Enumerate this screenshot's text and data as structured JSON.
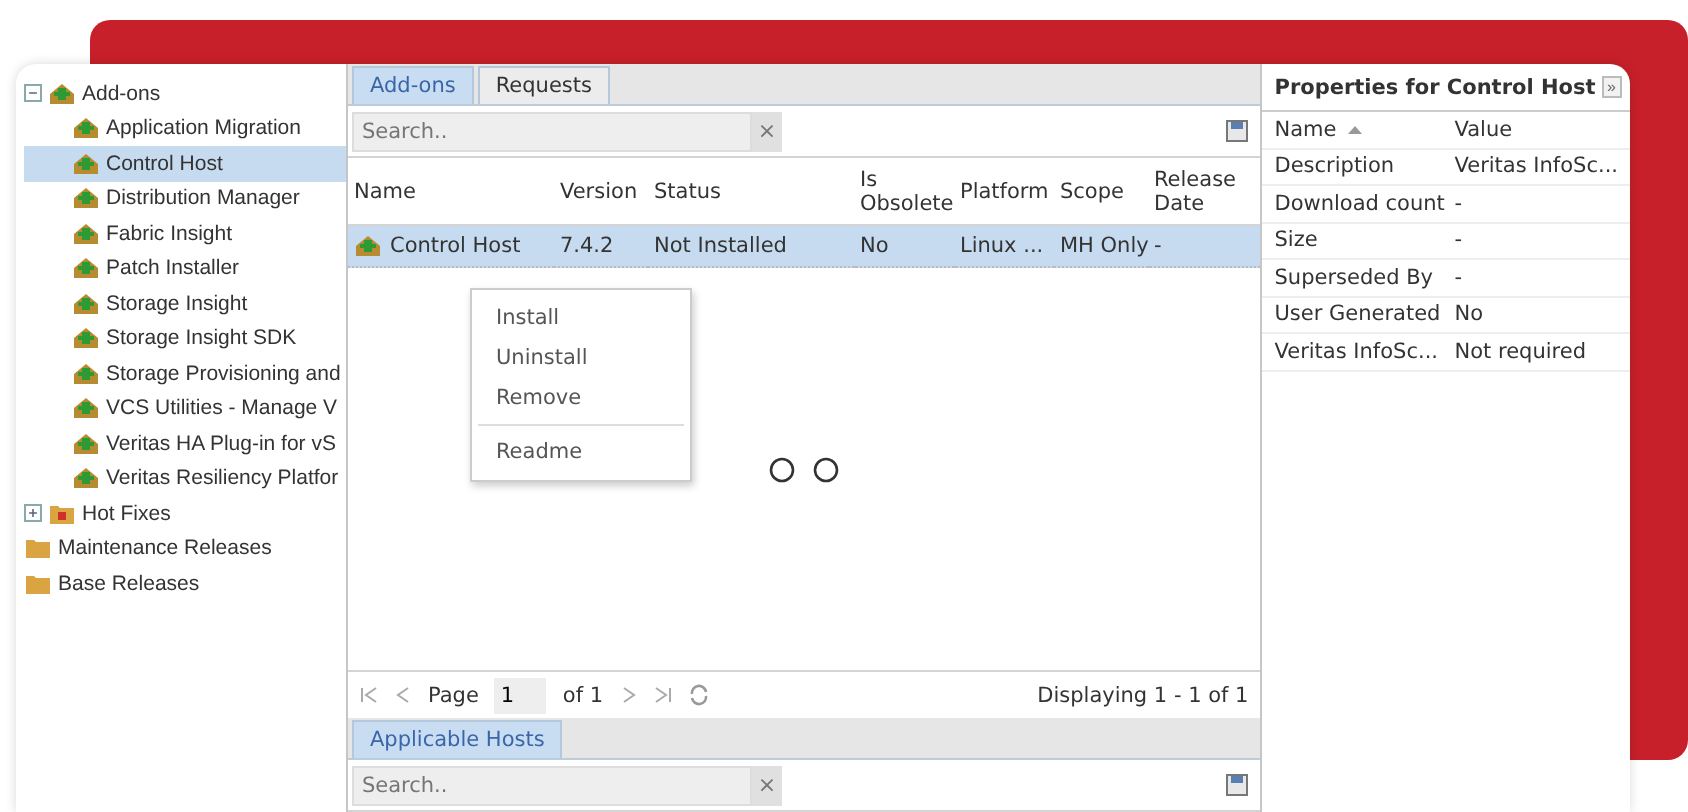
{
  "tree": [
    {
      "label": "Add-ons",
      "kind": "package-folder",
      "expanded": true,
      "selected": false,
      "children": [
        {
          "label": "Application Migration",
          "kind": "package",
          "selected": false
        },
        {
          "label": "Control Host",
          "kind": "package",
          "selected": true
        },
        {
          "label": "Distribution Manager",
          "kind": "package",
          "selected": false
        },
        {
          "label": "Fabric Insight",
          "kind": "package",
          "selected": false
        },
        {
          "label": "Patch Installer",
          "kind": "package",
          "selected": false
        },
        {
          "label": "Storage Insight",
          "kind": "package",
          "selected": false
        },
        {
          "label": "Storage Insight SDK",
          "kind": "package",
          "selected": false
        },
        {
          "label": "Storage Provisioning and",
          "kind": "package",
          "selected": false
        },
        {
          "label": "VCS Utilities - Manage V",
          "kind": "package",
          "selected": false
        },
        {
          "label": "Veritas HA Plug-in for vS",
          "kind": "package",
          "selected": false
        },
        {
          "label": "Veritas Resiliency Platfor",
          "kind": "package",
          "selected": false
        }
      ]
    },
    {
      "label": "Hot Fixes",
      "kind": "hotfix",
      "expanded": false,
      "selected": false
    },
    {
      "label": "Maintenance Releases",
      "kind": "folder",
      "selected": false
    },
    {
      "label": "Base Releases",
      "kind": "folder",
      "selected": false
    }
  ],
  "tabs": [
    {
      "label": "Add-ons",
      "selected": true
    },
    {
      "label": "Requests",
      "selected": false
    }
  ],
  "search": {
    "placeholder": "Search..",
    "clear": "×"
  },
  "table": {
    "columns": [
      "Name",
      "Version",
      "Status",
      "Is Obsolete",
      "Platform",
      "Scope",
      "Release Date"
    ],
    "rows": [
      {
        "selected": true,
        "cells": [
          "Control Host",
          "7.4.2",
          "Not Installed",
          "No",
          "Linux ...",
          "MH Only",
          "-"
        ]
      }
    ]
  },
  "context_menu": [
    {
      "label": "Install",
      "kind": "item"
    },
    {
      "label": "Uninstall",
      "kind": "item"
    },
    {
      "label": "Remove",
      "kind": "item"
    },
    {
      "kind": "separator"
    },
    {
      "label": "Readme",
      "kind": "item"
    }
  ],
  "paging": {
    "page_label": "Page",
    "page": "1",
    "of": "of 1",
    "displaying": "Displaying 1 - 1 of 1"
  },
  "bottom_tabs": [
    {
      "label": "Applicable Hosts",
      "selected": true
    }
  ],
  "bottom_search": {
    "placeholder": "Search..",
    "clear": "×"
  },
  "properties": {
    "title": "Properties for Control Host",
    "expand": "»",
    "columns": [
      "Name",
      "Value"
    ],
    "rows": [
      [
        "Description",
        "Veritas InfoSc..."
      ],
      [
        "Download count",
        "-"
      ],
      [
        "Size",
        "-"
      ],
      [
        "Superseded By",
        "-"
      ],
      [
        "User Generated",
        "No"
      ],
      [
        "Veritas InfoSc...",
        "Not required"
      ]
    ]
  }
}
